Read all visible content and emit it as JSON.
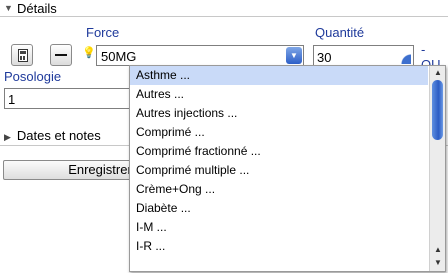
{
  "section": {
    "title": "Détails",
    "toggle_icon": "triangle-down-icon"
  },
  "force": {
    "label": "Force",
    "value": "50MG"
  },
  "quantity": {
    "label": "Quantité",
    "value": "30",
    "or_label": "-OU-"
  },
  "posology": {
    "label": "Posologie",
    "value": "1"
  },
  "dates_section": {
    "label": "Dates et notes",
    "toggle_icon": "triangle-right-icon"
  },
  "save_button": {
    "label": "Enregistrer"
  },
  "dropdown": {
    "selected_index": 0,
    "items": [
      "Asthme ...",
      "Autres ...",
      "Autres injections ...",
      "Comprimé ...",
      "Comprimé fractionné ...",
      "Comprimé multiple ...",
      "Crème+Ong ...",
      "Diabète ...",
      "I-M ...",
      "I-R ..."
    ]
  },
  "colors": {
    "label_blue": "#1f3a9b",
    "selection": "#c9daf8",
    "accent": "#2d5fc8"
  }
}
